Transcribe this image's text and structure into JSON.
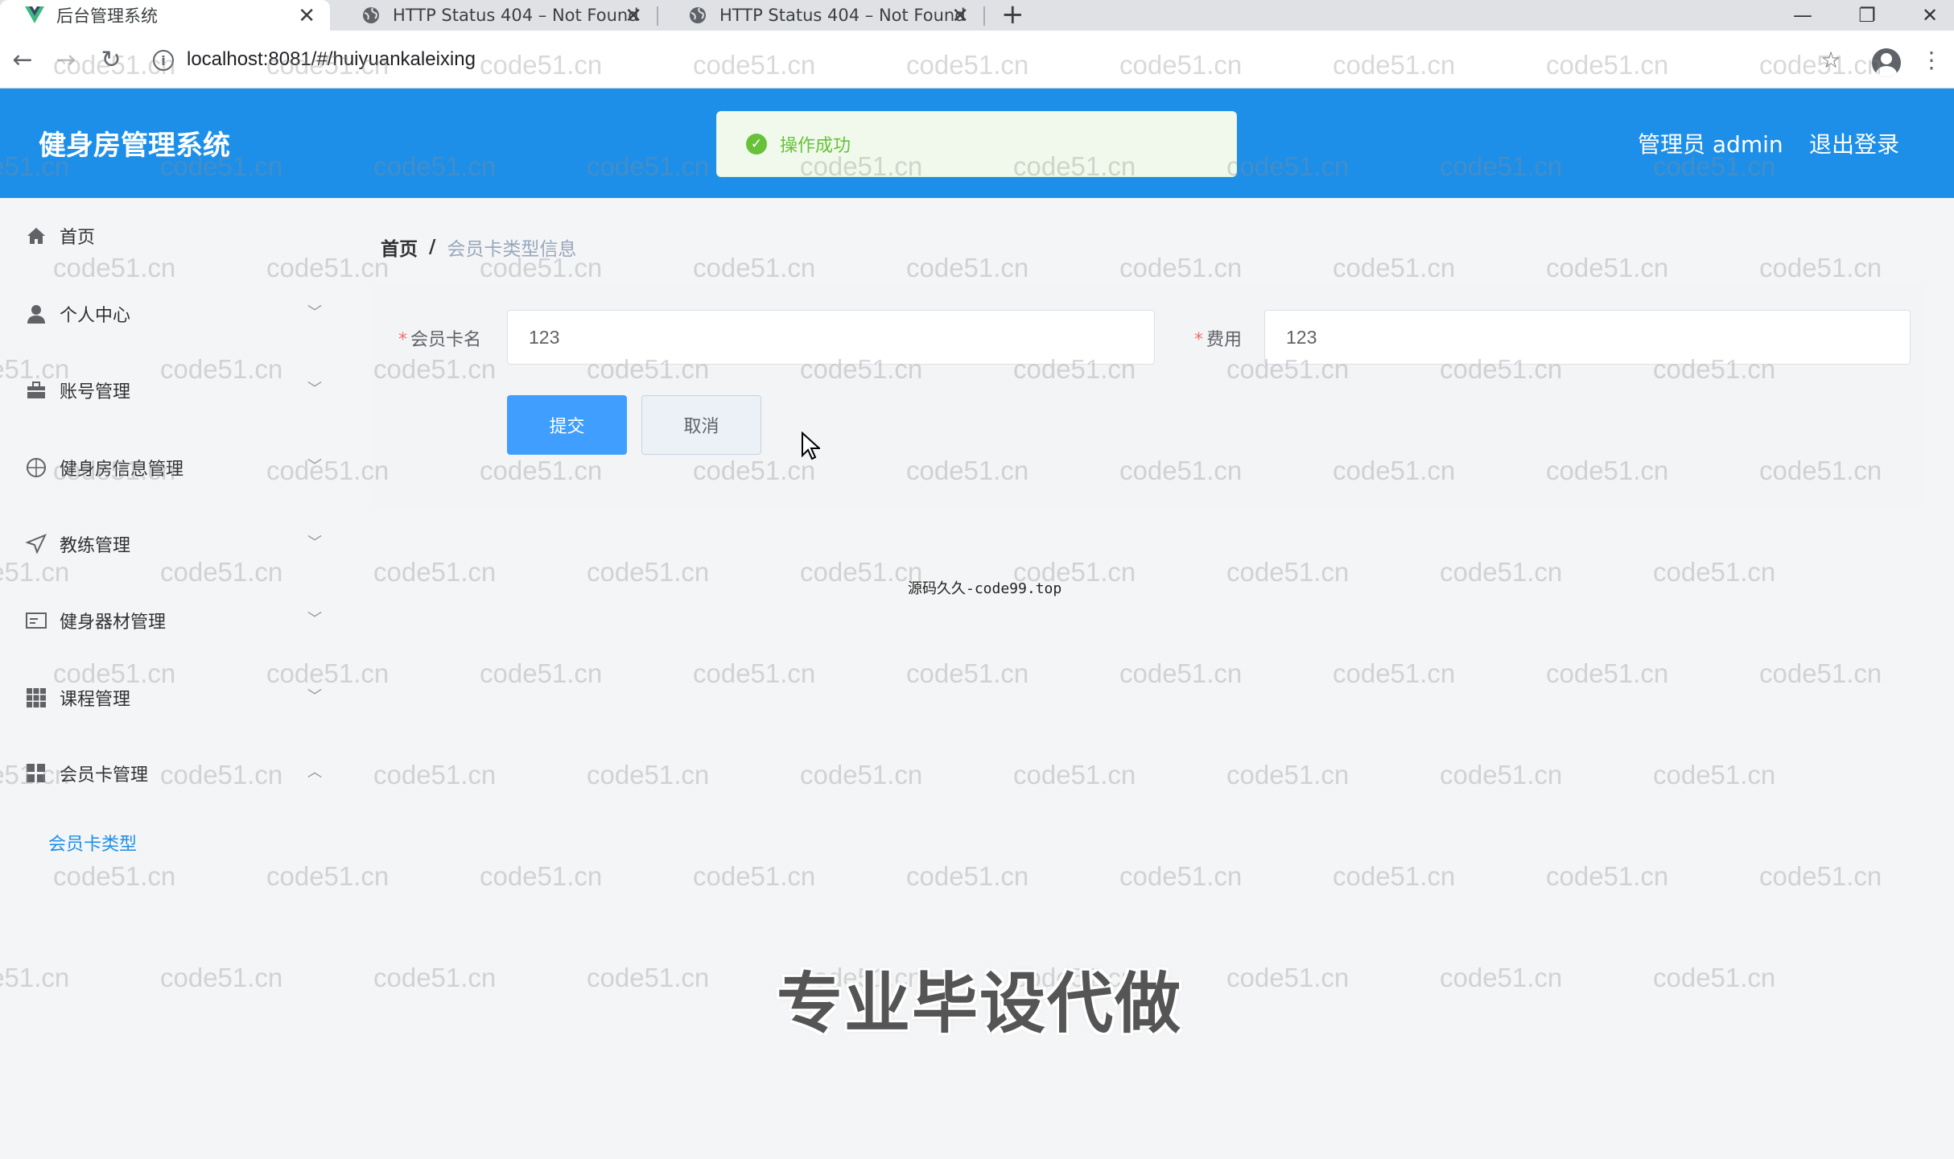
{
  "browser": {
    "tabs": [
      {
        "title": "后台管理系统",
        "icon": "vue-logo-icon",
        "active": true
      },
      {
        "title": "HTTP Status 404 – Not Found",
        "icon": "globe-icon",
        "active": false
      },
      {
        "title": "HTTP Status 404 – Not Found",
        "icon": "globe-icon",
        "active": false
      }
    ],
    "new_tab": "+",
    "url": "localhost:8081/#/huiyuankaleixing",
    "window_controls": {
      "minimize": "—",
      "restore": "❐",
      "close": "✕"
    }
  },
  "header": {
    "title": "健身房管理系统",
    "user": "管理员 admin",
    "logout": "退出登录",
    "bg_color": "#1e8fe8"
  },
  "toast": {
    "message": "操作成功",
    "type": "success",
    "color": "#67c23a"
  },
  "sidebar": {
    "items": [
      {
        "label": "首页",
        "icon": "home-icon",
        "expandable": false
      },
      {
        "label": "个人中心",
        "icon": "user-icon",
        "expandable": true
      },
      {
        "label": "账号管理",
        "icon": "briefcase-icon",
        "expandable": true
      },
      {
        "label": "健身房信息管理",
        "icon": "globe-icon",
        "expandable": true
      },
      {
        "label": "教练管理",
        "icon": "send-icon",
        "expandable": true
      },
      {
        "label": "健身器材管理",
        "icon": "card-icon",
        "expandable": true
      },
      {
        "label": "课程管理",
        "icon": "grid-icon",
        "expandable": true
      },
      {
        "label": "会员卡管理",
        "icon": "apps-icon",
        "expandable": true,
        "expanded": true
      }
    ],
    "submenu": {
      "label": "会员卡类型"
    }
  },
  "breadcrumb": {
    "home": "首页",
    "separator": "/",
    "current": "会员卡类型信息"
  },
  "form": {
    "fields": [
      {
        "label": "会员卡名",
        "value": "123",
        "required": true
      },
      {
        "label": "费用",
        "value": "123",
        "required": true
      }
    ],
    "submit": "提交",
    "cancel": "取消"
  },
  "overlays": {
    "watermark": "code51.cn",
    "source_note": "源码久久-code99.top",
    "banner": "专业毕设代做"
  }
}
